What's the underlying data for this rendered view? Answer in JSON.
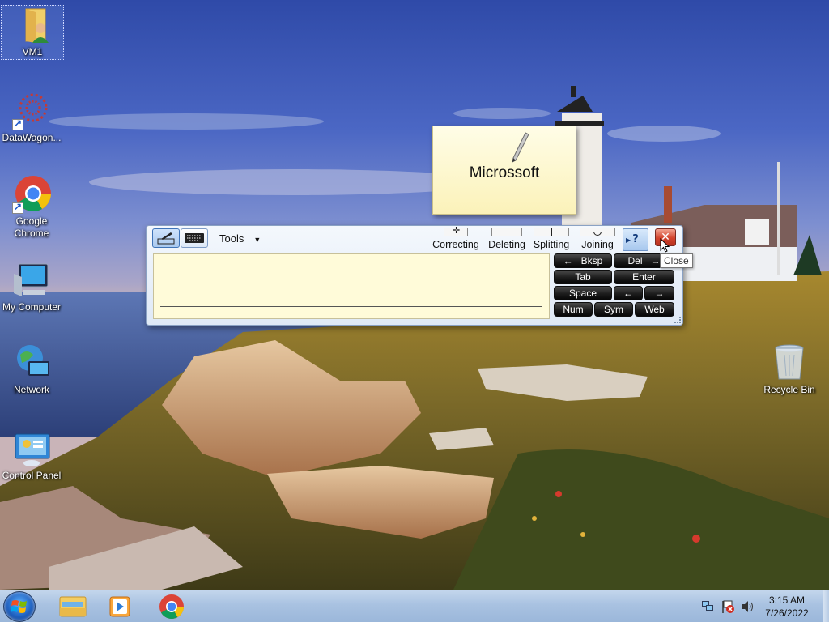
{
  "desktop": {
    "icons": [
      {
        "label": "VM1",
        "icon": "user-folder-icon"
      },
      {
        "label": "DataWagon...",
        "icon": "datawagon-app-icon"
      },
      {
        "label": "Google Chrome",
        "icon": "chrome-icon"
      },
      {
        "label": "My Computer",
        "icon": "computer-icon"
      },
      {
        "label": "Network",
        "icon": "network-icon"
      },
      {
        "label": "Control Panel",
        "icon": "control-panel-icon"
      },
      {
        "label": "Recycle Bin",
        "icon": "recycle-bin-icon"
      }
    ]
  },
  "handwriting_preview": {
    "text": "Microssoft",
    "icon": "pen-icon"
  },
  "tip_panel": {
    "tools_label": "Tools",
    "gestures": [
      "Correcting",
      "Deleting",
      "Splitting",
      "Joining"
    ],
    "help_icon": "help-icon",
    "close_icon": "close-icon",
    "keys": {
      "bksp": "Bksp",
      "bksp_arrow": "←",
      "del": "Del",
      "del_arrow": "→",
      "tab": "Tab",
      "enter": "Enter",
      "space": "Space",
      "left": "←",
      "right": "→",
      "num": "Num",
      "sym": "Sym",
      "web": "Web"
    }
  },
  "tooltip": {
    "text": "Close"
  },
  "taskbar": {
    "pinned": [
      "explorer-icon",
      "media-player-icon",
      "chrome-icon"
    ],
    "tray_icons": [
      "network-tray-icon",
      "action-center-flag-icon",
      "speaker-icon"
    ],
    "time": "3:15 AM",
    "date": "7/26/2022"
  },
  "colors": {
    "tip_background": "#dfe9f6",
    "writing_area": "#fffbd9",
    "key_fill": "#1c1c1c",
    "close_red": "#d2432c",
    "taskbar": "#a9c2e1"
  }
}
